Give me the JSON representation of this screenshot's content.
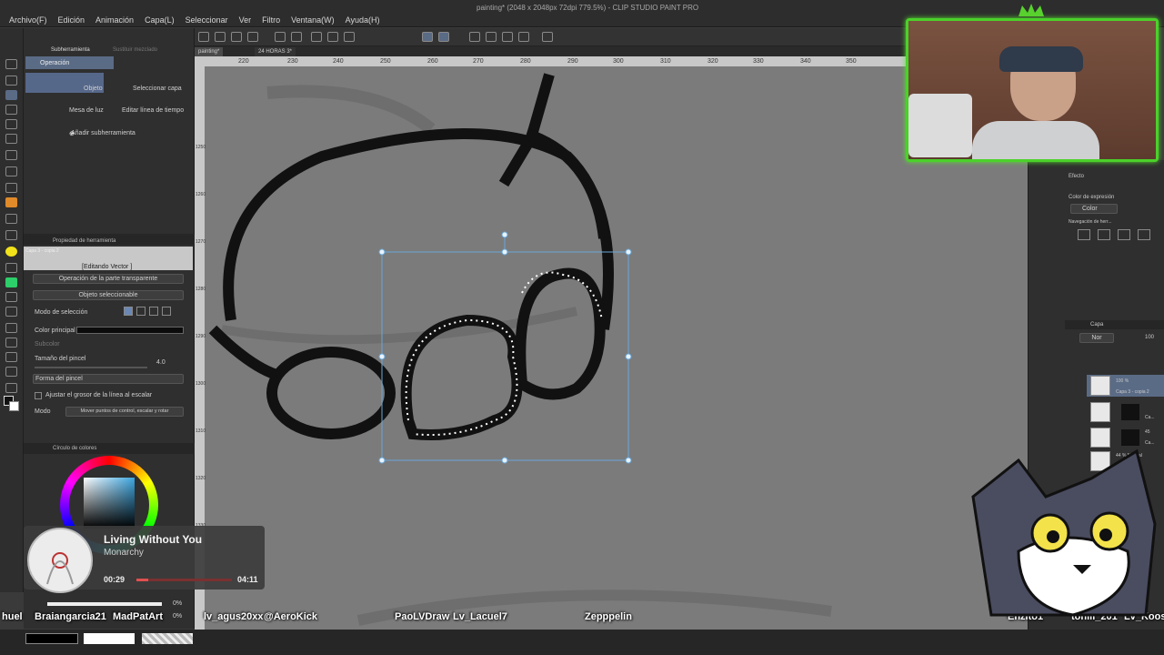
{
  "window": {
    "title": "painting* (2048 x 2048px 72dpi 779.5%) - CLIP STUDIO PAINT PRO"
  },
  "menu": [
    "Archivo(F)",
    "Edición",
    "Animación",
    "Capa(L)",
    "Seleccionar",
    "Ver",
    "Filtro",
    "Ventana(W)",
    "Ayuda(H)"
  ],
  "doc_tabs": [
    "painting*",
    "24 HORAS 3*"
  ],
  "ruler_top": [
    "220",
    "230",
    "240",
    "250",
    "260",
    "270",
    "280",
    "290",
    "300",
    "310",
    "320",
    "330",
    "340",
    "350"
  ],
  "ruler_left": [
    "1250",
    "1260",
    "1270",
    "1280",
    "1290",
    "1300",
    "1310",
    "1320",
    "1330"
  ],
  "subtool_panel": {
    "tab_label": "Subherramienta",
    "tab_label_2": "Sustituir mezclado",
    "group_label": "Operación",
    "items": [
      "Objeto",
      "Seleccionar capa",
      "Mesa de luz",
      "Editar línea de tiempo"
    ],
    "add_subtool": "Añadir subherramienta"
  },
  "tool_property": {
    "header": "Propiedad de herramienta",
    "layer_badge": "Capa 3 - copia 2",
    "editing": "[Editando Vector ]",
    "transparent_op": "Operación de la parte transparente",
    "selected_object": "Objeto seleccionable",
    "selection_mode": "Modo de selección",
    "main_color": "Color principal",
    "sub_color": "Subcolor",
    "brush_size_label": "Tamaño del pincel",
    "brush_size_value": "4.0",
    "brush_shape": "Forma del pincel",
    "adjust_width": "Ajustar el grosor de la línea al escalar",
    "mode_label": "Modo",
    "mode_value": "Mover puntos de control, escalar y rotar"
  },
  "color_wheel": {
    "header": "Círculo de colores"
  },
  "music": {
    "song": "Living Without You",
    "artist": "Monarchy",
    "elapsed": "00:29",
    "total": "04:11",
    "progress": 0.12
  },
  "right_panel": {
    "effect_label": "Efecto",
    "expression_color": "Color de expresión",
    "color_value": "Color",
    "nav_label": "Navegación de herr...",
    "layer_header": "Capa",
    "layers": [
      {
        "opacity": "100 %",
        "name": "Capa 3 - copia 2"
      },
      {
        "opacity": "",
        "name": "Ca..."
      },
      {
        "opacity": "45",
        "name": "Ca..."
      },
      {
        "opacity": "44 % Normal",
        "name": "copia"
      }
    ],
    "blend_value": "Nor",
    "opacity_value": "100"
  },
  "chat_names": [
    "huel",
    "Braiangarcia21",
    "MadPatArt",
    "lv_agus20xx",
    "@AeroKick",
    "PaoLVDraw",
    "Lv_Lacuel7",
    "Zepppelin",
    "Enzito1",
    "toniii_201",
    "Lv_Koosa"
  ],
  "status": {
    "pct1": "0%",
    "pct2": "0%"
  },
  "colors": {
    "accent_green": "#4bd12a",
    "selection_blue": "#6aa7d8",
    "canvas_gray": "#7b7b7b"
  }
}
